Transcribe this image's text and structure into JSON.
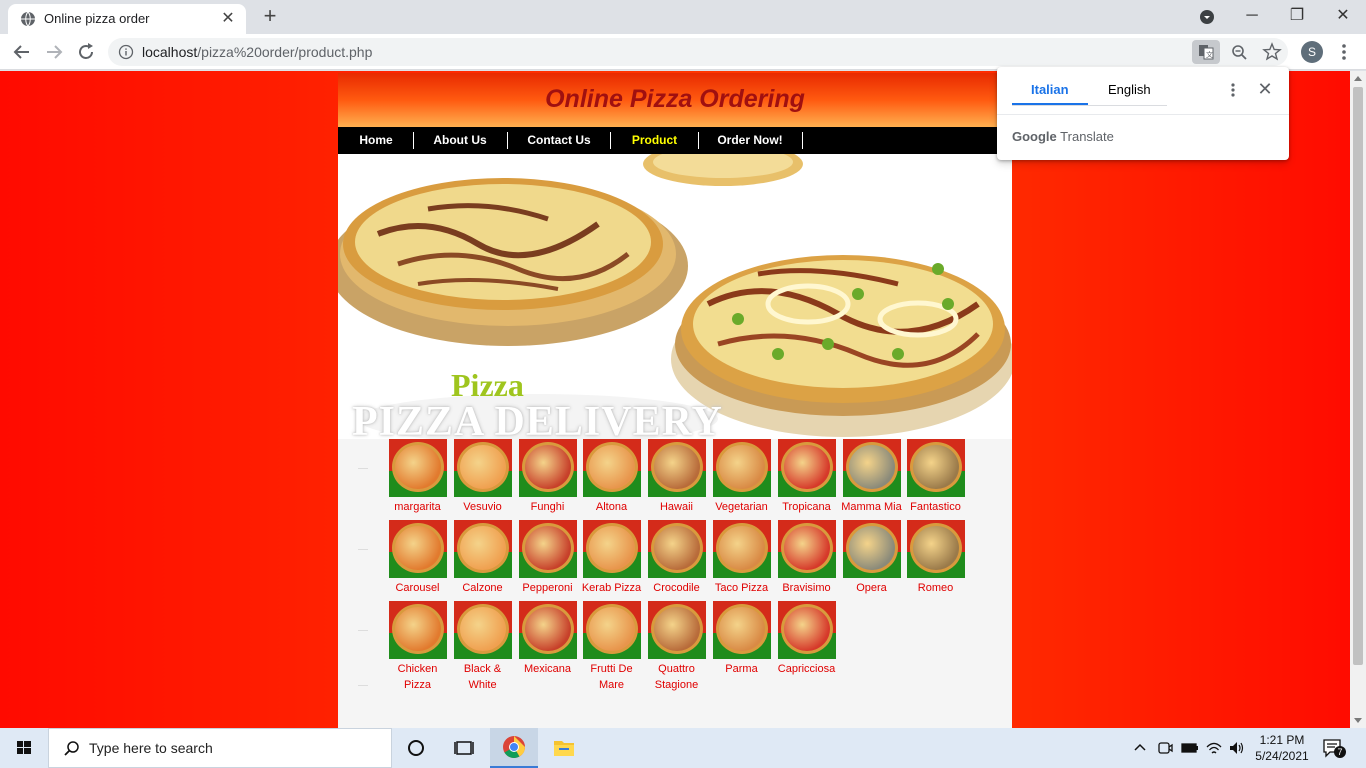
{
  "browser": {
    "tab_title": "Online pizza order",
    "url_host": "localhost",
    "url_path": "/pizza%20order/product.php",
    "profile_initial": "S"
  },
  "site": {
    "title": "Online Pizza Ordering",
    "nav": [
      {
        "label": "Home"
      },
      {
        "label": "About Us"
      },
      {
        "label": "Contact Us"
      },
      {
        "label": "Product",
        "active": true
      },
      {
        "label": "Order Now!"
      }
    ],
    "banner_word": "Pizza",
    "banner_tagline": "PIZZA DELIVERY",
    "products": [
      [
        "margarita",
        "Vesuvio",
        "Funghi",
        "Altona",
        "Hawaii",
        "Vegetarian",
        "Tropicana",
        "Mamma Mia",
        "Fantastico"
      ],
      [
        "Carousel",
        "Calzone",
        "Pepperoni",
        "Kerab Pizza",
        "Crocodile Pizza",
        "Taco Pizza",
        "Bravisimo",
        "Opera",
        "Romeo"
      ],
      [
        "Chicken Pizza",
        "Black & White",
        "Mexicana",
        "Frutti De Mare",
        "Quattro Stagione",
        "Parma",
        "Capricciosa"
      ]
    ]
  },
  "translate_popup": {
    "languages": [
      "Italian",
      "English"
    ],
    "active_language": "Italian",
    "brand_google": "Google",
    "brand_translate": "Translate"
  },
  "taskbar": {
    "search_placeholder": "Type here to search",
    "time": "1:21 PM",
    "date": "5/24/2021",
    "notification_count": "7"
  },
  "colors": {
    "page_bg": "#ff2a00",
    "nav_bg": "#000000",
    "nav_active": "#ffff00",
    "product_label": "#e00000",
    "title": "#a01010"
  }
}
